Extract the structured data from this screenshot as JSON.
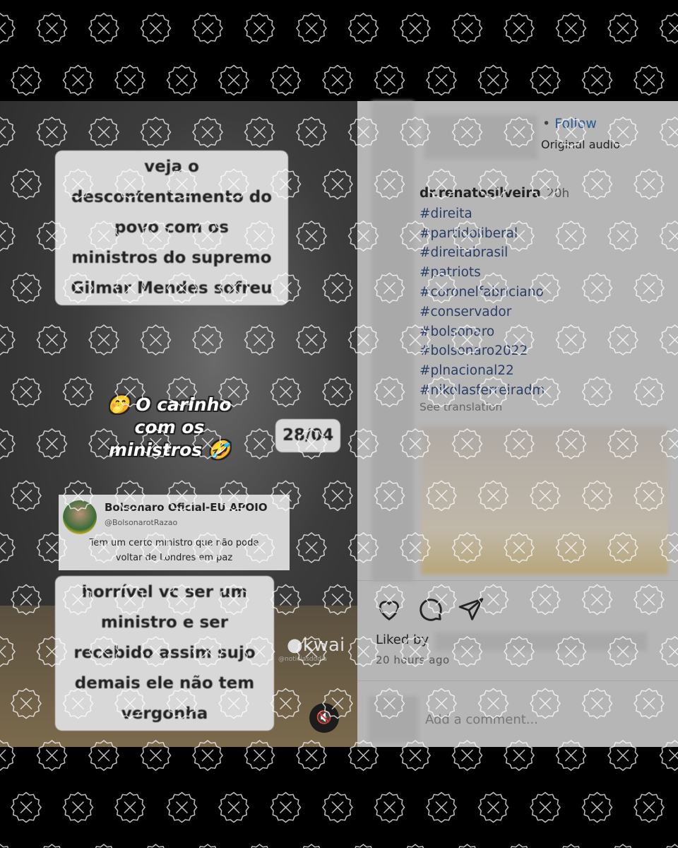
{
  "video": {
    "caption_top": [
      "veja o",
      "descontentamento do",
      "povo com os",
      "ministros do supremo",
      "Gilmar Mendes sofreu"
    ],
    "overlay_text": [
      "🤭 O carinho",
      "com os",
      "ministros 🤣"
    ],
    "date_badge": "28/04",
    "tweet": {
      "name": "Bolsonaro Oficial-EU APOIO",
      "handle": "@BolsonarotRazao",
      "body_lines": [
        "Tem um certo ministro que não pode",
        "voltar de Londres em paz"
      ]
    },
    "caption_bottom": [
      "horrível vc ser um",
      "ministro e ser",
      "recebido assim sujo",
      "demais ele não tem",
      "vergonha"
    ],
    "watermark_brand": "kwai",
    "watermark_handle": "@noticiasdodia",
    "mute_icon": "speaker-muted-icon"
  },
  "post": {
    "follow_separator": "•",
    "follow_label": "Follow",
    "audio_label": "Original audio",
    "username": "dr.renatosilveira",
    "time": "20h",
    "hashtags": [
      "#direita",
      "#partidoliberal",
      "#direitabrasil",
      "#patriots",
      "#coronelfabriciano",
      "#conservador",
      "#bolsonaro",
      "#bolsonaro2022",
      "#plnacional22",
      "#nikolasferreiradm"
    ],
    "see_translation": "See translation",
    "actions": [
      "heart-icon",
      "comment-icon",
      "share-icon"
    ],
    "liked_by": "Liked by",
    "time_ago": "20 hours ago",
    "comment_placeholder": "Add a comment..."
  },
  "colors": {
    "follow": "#245b94",
    "panel_bg": "#b6b6b6",
    "hashtag": "#2a3d66"
  }
}
